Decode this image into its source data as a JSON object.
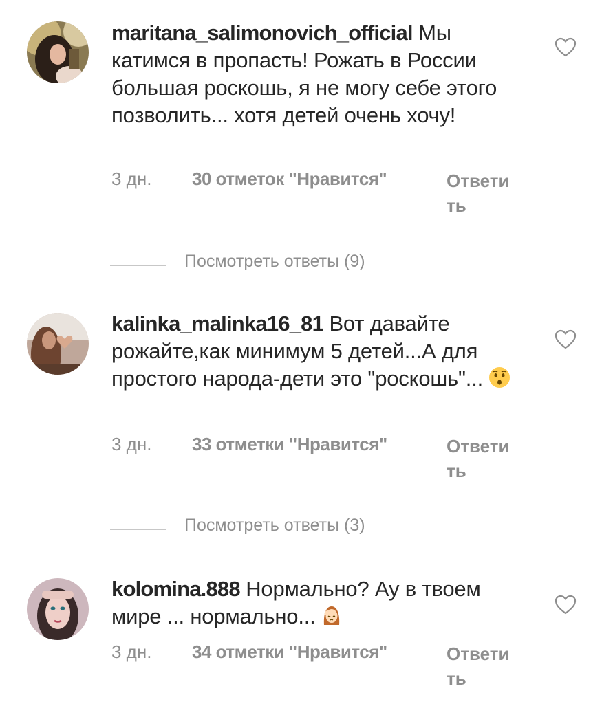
{
  "comments": [
    {
      "username": "maritana_salimonovich_official",
      "text": " Мы катимся в пропасть! Рожать в России большая роскошь, я не могу себе этого  позволить... хотя детей очень хочу!",
      "time": "3 дн.",
      "likes": "30 отметок \"Нравится\"",
      "reply": "Ответить",
      "view_replies": "Посмотреть ответы (9)",
      "avatar_icon": "avatar-woman-dark-hair"
    },
    {
      "username": "kalinka_malinka16_81",
      "text": " Вот давайте рожайте,как минимум 5 детей...А для простого народа-дети это \"роскошь\"...",
      "emoji": "hushed-face-emoji",
      "time": "3 дн.",
      "likes": "33 отметки \"Нравится\"",
      "reply": "Ответить",
      "view_replies": "Посмотреть ответы (3)",
      "avatar_icon": "avatar-woman-heart-hands"
    },
    {
      "username": "kolomina.888",
      "text": " Нормально? Ау в твоем мире ... нормально...",
      "emoji": "facepalm-woman-emoji",
      "time": "3 дн.",
      "likes": "34 отметки \"Нравится\"",
      "reply": "Ответить",
      "avatar_icon": "avatar-woman-face"
    }
  ],
  "colors": {
    "text": "#262626",
    "secondary": "#8e8e8e",
    "divider": "#c7c7c7"
  }
}
